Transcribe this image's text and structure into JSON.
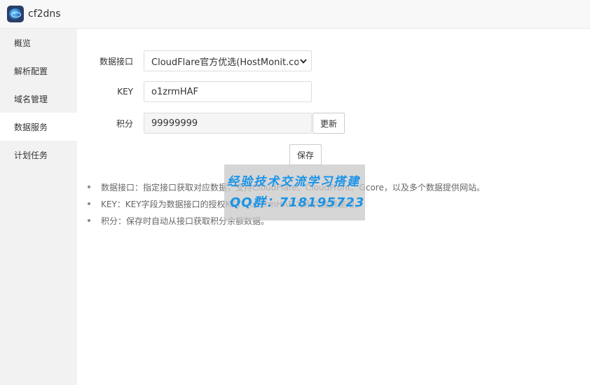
{
  "header": {
    "title": "cf2dns"
  },
  "sidebar": {
    "items": [
      {
        "label": "概览"
      },
      {
        "label": "解析配置"
      },
      {
        "label": "域名管理"
      },
      {
        "label": "数据服务"
      },
      {
        "label": "计划任务"
      }
    ]
  },
  "form": {
    "interface_label": "数据接口",
    "interface_value": "CloudFlare官方优选(HostMonit.com)",
    "key_label": "KEY",
    "key_value": "o1zrmHAF",
    "points_label": "积分",
    "points_value": "99999999",
    "refresh_label": "更新",
    "save_label": "保存"
  },
  "notes": [
    "数据接口：指定接口获取对应数据，支持CloudFlare、CloudFront、Gcore，以及多个数据提供网站。",
    "KEY：KEY字段为数据接口的授权KEY，o1zrmHAF 为永久免费使用。",
    "积分：保存时自动从接口获取积分余额数据。"
  ],
  "watermark": {
    "line1": "经验技术交流学习搭建",
    "line2": "QQ群：718195723"
  }
}
